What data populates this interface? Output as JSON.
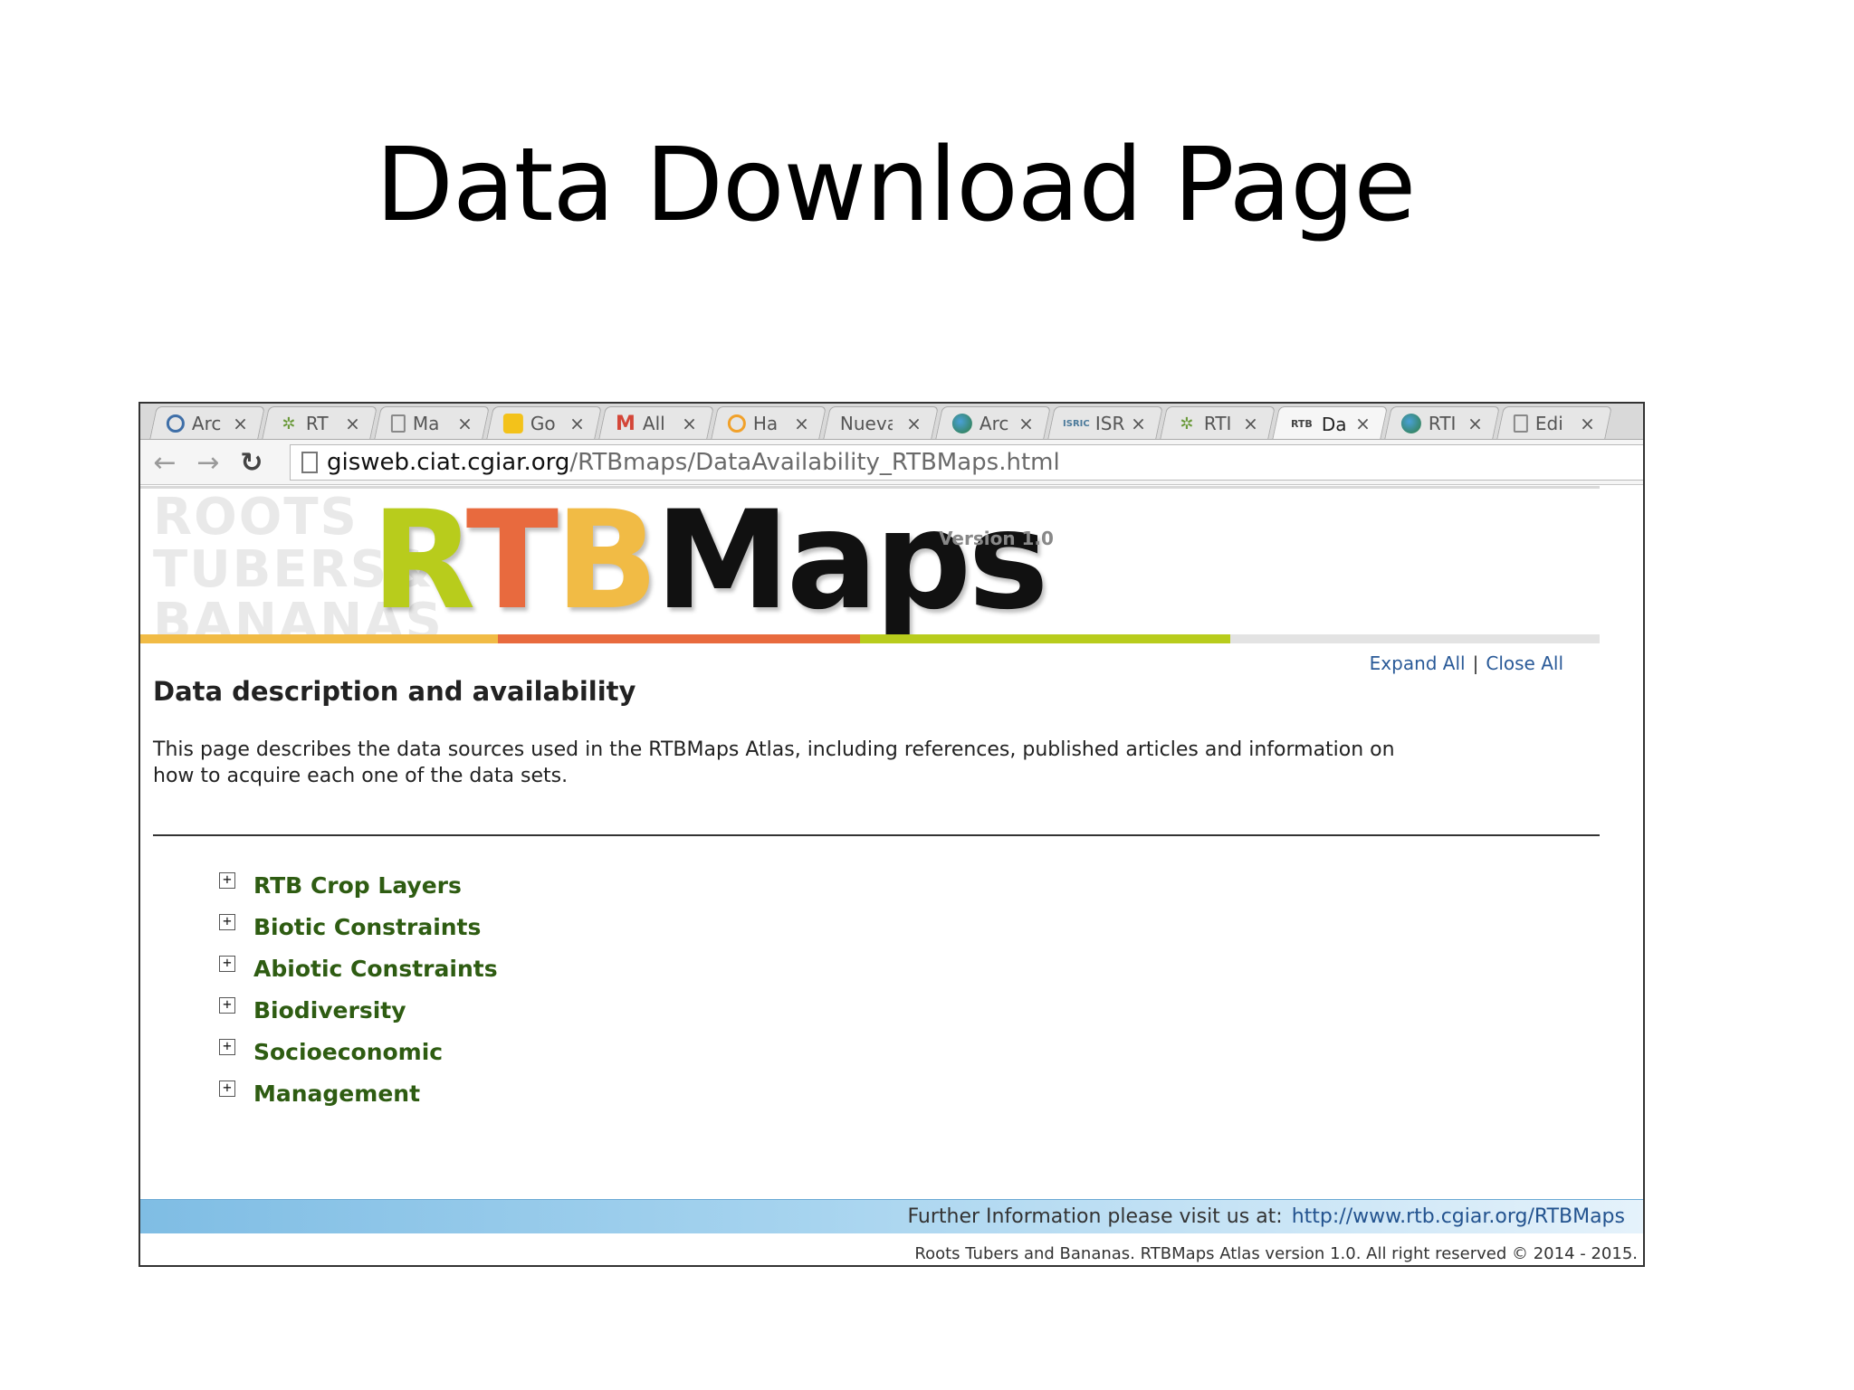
{
  "slide": {
    "title": "Data Download Page"
  },
  "browser": {
    "tabs": [
      {
        "label": "Arc",
        "icon": "arcgis-icon",
        "icon_color": "#3f6fa8",
        "active": false
      },
      {
        "label": "RT",
        "icon": "plant-icon",
        "icon_color": "#6a9a3a",
        "active": false
      },
      {
        "label": "Ma",
        "icon": "document-icon",
        "icon_color": "#ffffff",
        "active": false
      },
      {
        "label": "Go",
        "icon": "bulb-icon",
        "icon_color": "#f3c21a",
        "active": false
      },
      {
        "label": "All",
        "icon": "gmail-icon",
        "icon_color": "#d44638",
        "active": false
      },
      {
        "label": "Ha",
        "icon": "swirl-icon",
        "icon_color": "#f1a12a",
        "active": false
      },
      {
        "label": "Nueva",
        "icon": "",
        "icon_color": "",
        "active": false
      },
      {
        "label": "Arc",
        "icon": "globe-icon",
        "icon_color": "#2f7d3e",
        "active": false
      },
      {
        "label": "ISR",
        "icon": "isric-icon",
        "icon_color": "#4d7b9b",
        "active": false
      },
      {
        "label": "RTI",
        "icon": "plant-icon",
        "icon_color": "#6a9a3a",
        "active": false
      },
      {
        "label": "Da",
        "icon": "rtb-icon",
        "icon_color": "#444444",
        "active": true
      },
      {
        "label": "RTI",
        "icon": "globe-icon",
        "icon_color": "#2f7d3e",
        "active": false
      },
      {
        "label": "Edi",
        "icon": "document-icon",
        "icon_color": "#ffffff",
        "active": false
      }
    ],
    "close_glyph": "×",
    "url_host": "gisweb.ciat.cgiar.org",
    "url_path": "/RTBmaps/DataAvailability_RTBMaps.html"
  },
  "page": {
    "watermark_lines": [
      "ROOTS",
      "TUBERS&",
      "BANANAS"
    ],
    "logo": {
      "r": "R",
      "t": "T",
      "b": "B",
      "maps": "Maps"
    },
    "version": "Version 1.0",
    "expand_all": "Expand All",
    "separator": "|",
    "close_all": "Close All",
    "heading": "Data description and availability",
    "description": "This page describes the data sources used in the RTBMaps Atlas, including references, published articles and information on how to acquire each one of the data sets.",
    "expand_glyph": "+",
    "categories": [
      "RTB Crop Layers",
      "Biotic Constraints",
      "Abiotic Constraints",
      "Biodiversity",
      "Socioeconomic",
      "Management"
    ],
    "footer_text": "Further Information please visit us at:",
    "footer_link": "http://www.rtb.cgiar.org/RTBMaps",
    "copyright": "Roots Tubers and Bananas. RTBMaps Atlas version 1.0. All right reserved © 2014 - 2015."
  },
  "colors": {
    "logo_green": "#b8cc1c",
    "logo_orange": "#e86a3e",
    "logo_yellow": "#f1bb45",
    "category_green": "#2e5c12",
    "link_blue": "#2a5a98",
    "bar_segments": [
      "#f1bb45",
      "#e86a3e",
      "#b8cc1c",
      "#e3e3e3"
    ]
  }
}
